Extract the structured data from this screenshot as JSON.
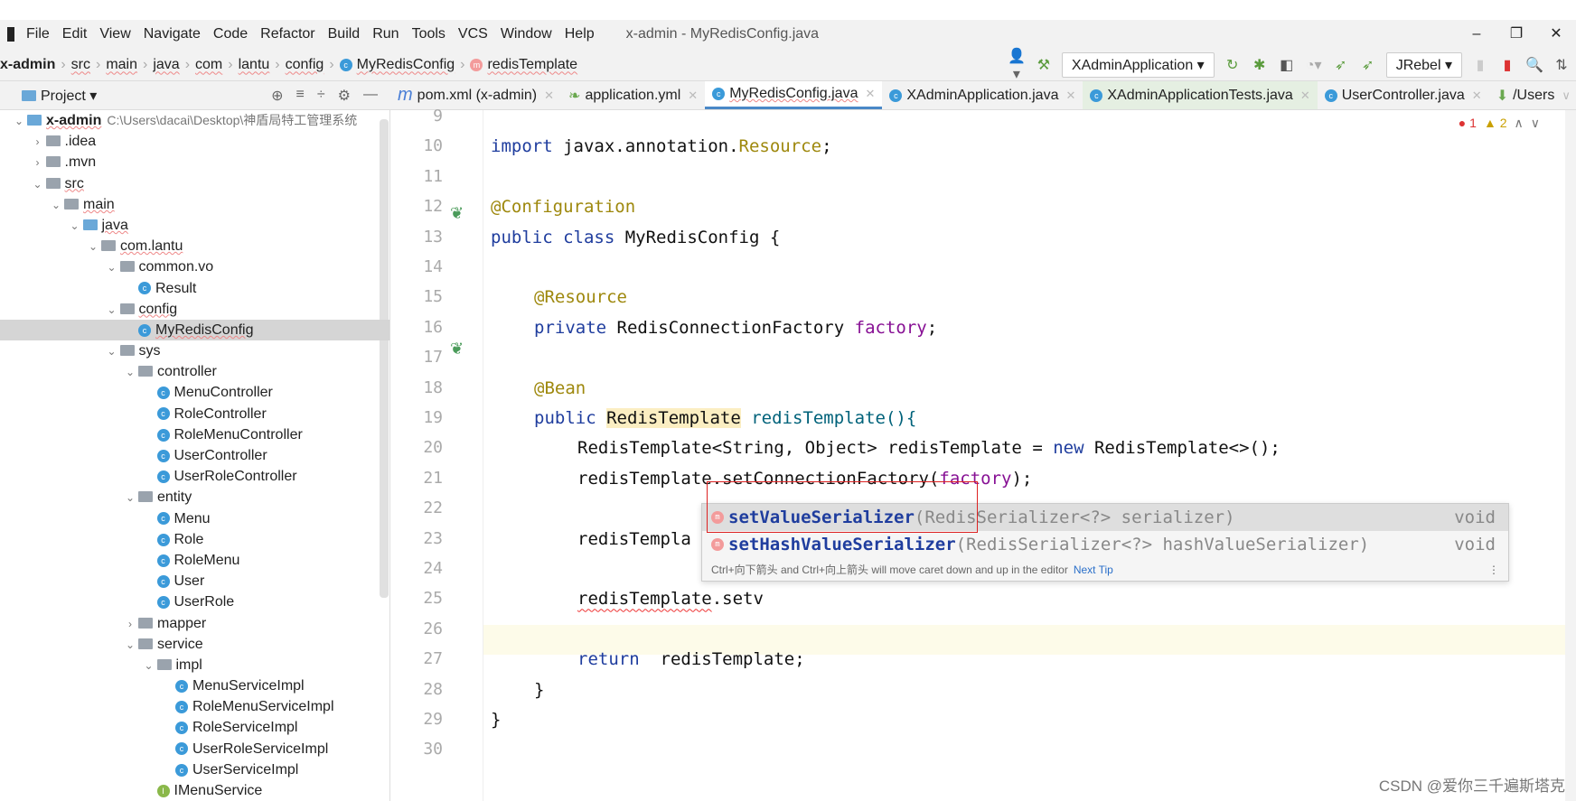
{
  "menu": {
    "items": [
      "File",
      "Edit",
      "View",
      "Navigate",
      "Code",
      "Refactor",
      "Build",
      "Run",
      "Tools",
      "VCS",
      "Window",
      "Help"
    ],
    "title": "x-admin - MyRedisConfig.java"
  },
  "window_controls": [
    "–",
    "❐",
    "✕"
  ],
  "breadcrumb": [
    "x-admin",
    "src",
    "main",
    "java",
    "com",
    "lantu",
    "config",
    "MyRedisConfig",
    "redisTemplate"
  ],
  "toolbar": {
    "run_config": "XAdminApplication",
    "jrebel": "JRebel"
  },
  "project": {
    "label": "Project",
    "root": "x-admin",
    "root_path": "C:\\Users\\dacai\\Desktop\\神盾局特工管理系统",
    "tree": [
      {
        "label": "x-admin",
        "level": 0,
        "type": "module",
        "open": true
      },
      {
        "label": ".idea",
        "level": 1,
        "type": "folder",
        "open": false
      },
      {
        "label": ".mvn",
        "level": 1,
        "type": "folder",
        "open": false
      },
      {
        "label": "src",
        "level": 1,
        "type": "folder",
        "open": true
      },
      {
        "label": "main",
        "level": 2,
        "type": "folder",
        "open": true
      },
      {
        "label": "java",
        "level": 3,
        "type": "srcfolder",
        "open": true
      },
      {
        "label": "com.lantu",
        "level": 4,
        "type": "folder",
        "open": true
      },
      {
        "label": "common.vo",
        "level": 5,
        "type": "folder",
        "open": true
      },
      {
        "label": "Result",
        "level": 6,
        "type": "class"
      },
      {
        "label": "config",
        "level": 5,
        "type": "folder",
        "open": true
      },
      {
        "label": "MyRedisConfig",
        "level": 6,
        "type": "class",
        "selected": true
      },
      {
        "label": "sys",
        "level": 5,
        "type": "folder",
        "open": true
      },
      {
        "label": "controller",
        "level": 6,
        "type": "folder",
        "open": true
      },
      {
        "label": "MenuController",
        "level": 7,
        "type": "class"
      },
      {
        "label": "RoleController",
        "level": 7,
        "type": "class"
      },
      {
        "label": "RoleMenuController",
        "level": 7,
        "type": "class"
      },
      {
        "label": "UserController",
        "level": 7,
        "type": "class"
      },
      {
        "label": "UserRoleController",
        "level": 7,
        "type": "class"
      },
      {
        "label": "entity",
        "level": 6,
        "type": "folder",
        "open": true
      },
      {
        "label": "Menu",
        "level": 7,
        "type": "class"
      },
      {
        "label": "Role",
        "level": 7,
        "type": "class"
      },
      {
        "label": "RoleMenu",
        "level": 7,
        "type": "class"
      },
      {
        "label": "User",
        "level": 7,
        "type": "class"
      },
      {
        "label": "UserRole",
        "level": 7,
        "type": "class"
      },
      {
        "label": "mapper",
        "level": 6,
        "type": "folder",
        "open": false
      },
      {
        "label": "service",
        "level": 6,
        "type": "folder",
        "open": true
      },
      {
        "label": "impl",
        "level": 7,
        "type": "folder",
        "open": true
      },
      {
        "label": "MenuServiceImpl",
        "level": 8,
        "type": "class"
      },
      {
        "label": "RoleMenuServiceImpl",
        "level": 8,
        "type": "class"
      },
      {
        "label": "RoleServiceImpl",
        "level": 8,
        "type": "class"
      },
      {
        "label": "UserRoleServiceImpl",
        "level": 8,
        "type": "class"
      },
      {
        "label": "UserServiceImpl",
        "level": 8,
        "type": "class"
      },
      {
        "label": "IMenuService",
        "level": 7,
        "type": "interface"
      }
    ]
  },
  "tabs": [
    {
      "label": "pom.xml (x-admin)",
      "icon": "m"
    },
    {
      "label": "application.yml",
      "icon": "yml"
    },
    {
      "label": "MyRedisConfig.java",
      "icon": "c",
      "active": true
    },
    {
      "label": "XAdminApplication.java",
      "icon": "c"
    },
    {
      "label": "XAdminApplicationTests.java",
      "icon": "c",
      "green": true
    },
    {
      "label": "UserController.java",
      "icon": "c"
    },
    {
      "label": "/Users",
      "icon": "api"
    }
  ],
  "inspections": {
    "errors": "1",
    "warnings": "2"
  },
  "code": {
    "line_numbers": [
      "9",
      "10",
      "11",
      "12",
      "13",
      "14",
      "15",
      "16",
      "17",
      "18",
      "19",
      "20",
      "21",
      "22",
      "23",
      "24",
      "25",
      "26",
      "27",
      "28",
      "29",
      "30"
    ],
    "l10": [
      "import ",
      "javax.annotation.",
      "Resource",
      ";"
    ],
    "l12": "@Configuration",
    "l13": [
      "public class ",
      "MyRedisConfig {"
    ],
    "l15": "@Resource",
    "l16": [
      "private ",
      "RedisConnectionFactory ",
      "factory",
      ";"
    ],
    "l18": "@Bean",
    "l19": [
      "public ",
      "RedisTemplate",
      " redisTemplate(){"
    ],
    "l20": [
      "RedisTemplate<String, Object> redisTemplate = ",
      "new ",
      "RedisTemplate<>();"
    ],
    "l21": [
      "redisTemplate.setConnectionFactory(",
      "factory",
      ");"
    ],
    "l23": "redisTempla",
    "l25": [
      "redisTemplate",
      ".setv"
    ],
    "l27": [
      "return ",
      "redisTemplate;"
    ],
    "l28": "}",
    "l29": "}"
  },
  "completion": {
    "items": [
      {
        "prefix": "setV",
        "name": "setValueSerializer",
        "name_rest": "alueSerializer",
        "params": "(RedisSerializer<?> serializer)",
        "type": "void"
      },
      {
        "prefix": "setHashV",
        "name": "setHashValueSerializer",
        "name_rest": "alueSerializer",
        "params": "(RedisSerializer<?> hashValueSerializer)",
        "type": "void"
      }
    ],
    "tip": "Ctrl+向下箭头 and Ctrl+向上箭头 will move caret down and up in the editor",
    "next_tip": "Next Tip"
  },
  "watermark": "CSDN @爱你三千遍斯塔克"
}
